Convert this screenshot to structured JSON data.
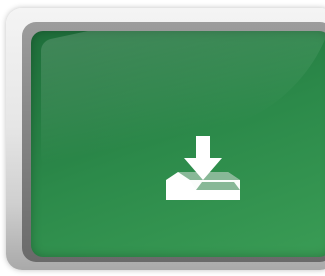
{
  "colors": {
    "screen_green_dark": "#1f6f3b",
    "screen_green_light": "#3a9c55",
    "icon_white": "#ffffff"
  },
  "icons": {
    "main": "download-to-inbox-icon"
  }
}
